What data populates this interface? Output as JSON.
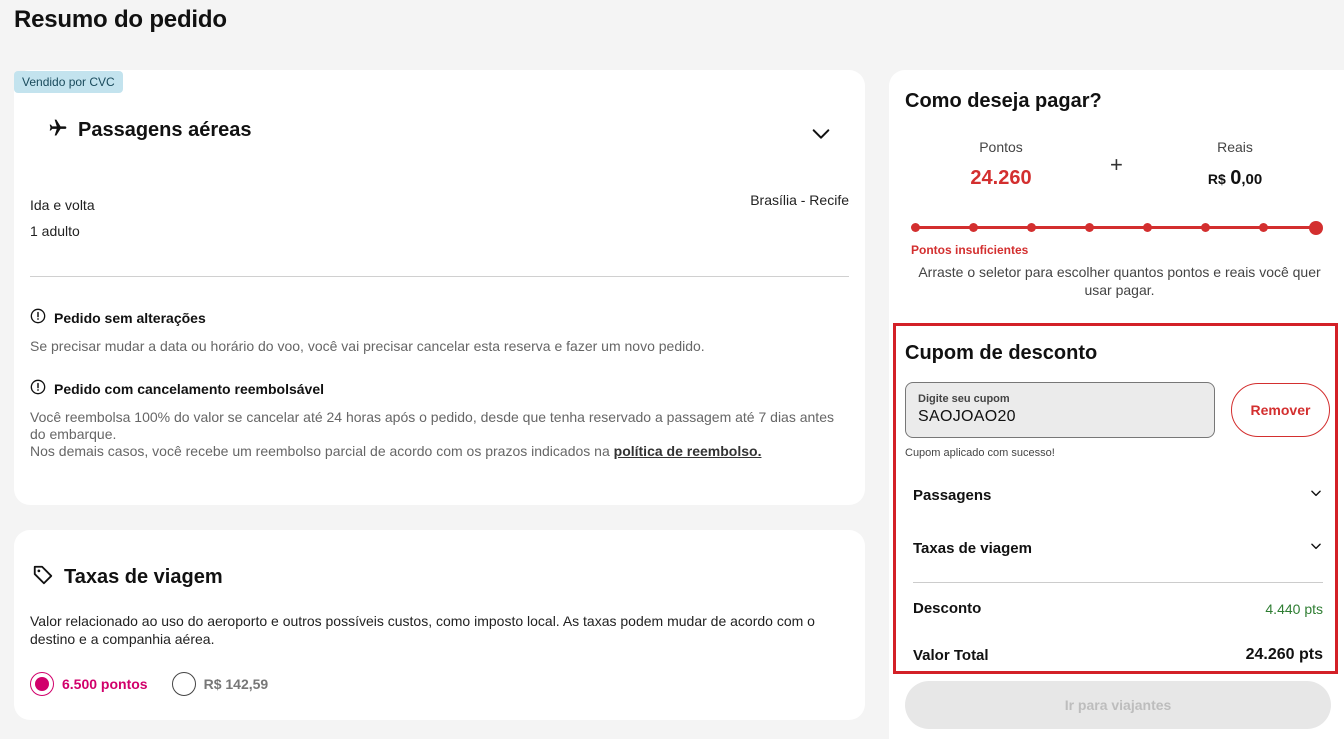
{
  "page": {
    "title": "Resumo do pedido"
  },
  "flight": {
    "badge": "Vendido por CVC",
    "title": "Passagens aéreas",
    "trip_type": "Ida e volta",
    "passengers": "1 adulto",
    "route": "Brasília - Recife",
    "notices": [
      {
        "title": "Pedido sem alterações",
        "body": "Se precisar mudar a data ou horário do voo, você vai precisar cancelar esta reserva e fazer um novo pedido."
      },
      {
        "title": "Pedido com cancelamento reembolsável",
        "body": "Você reembolsa 100% do valor se cancelar até 24 horas após o pedido, desde que tenha reservado a passagem até 7 dias antes do embarque.",
        "body2": "Nos demais casos, você recebe um reembolso parcial de acordo com os prazos indicados na",
        "link": "política de reembolso."
      }
    ]
  },
  "taxes": {
    "title": "Taxas de viagem",
    "description": "Valor relacionado ao uso do aeroporto e outros possíveis custos, como imposto local. As taxas podem mudar de acordo com o destino e a companhia aérea.",
    "options": [
      {
        "label": "6.500 pontos",
        "selected": true
      },
      {
        "label": "R$ 142,59",
        "selected": false
      }
    ]
  },
  "payment": {
    "title": "Como deseja pagar?",
    "points_label": "Pontos",
    "points_value": "24.260",
    "plus": "+",
    "reais_label": "Reais",
    "reais_currency": "R$",
    "reais_int": "0",
    "reais_dec": ",00",
    "slider_level": 1.0,
    "insufficient": "Pontos insuficientes",
    "hint": "Arraste o seletor para escolher quantos pontos e reais você quer usar pagar."
  },
  "coupon": {
    "title": "Cupom de desconto",
    "placeholder": "Digite seu cupom",
    "value": "SAOJOAO20",
    "remove_label": "Remover",
    "success": "Cupom aplicado com sucesso!"
  },
  "summary": {
    "passagens": "Passagens",
    "taxas": "Taxas de viagem",
    "desconto_label": "Desconto",
    "desconto_value": "4.440 pts",
    "total_label": "Valor Total",
    "total_value": "24.260 pts"
  },
  "cta": {
    "label": "Ir para viajantes"
  },
  "colors": {
    "accent_red": "#d32f2f",
    "pink": "#d1006b",
    "green": "#2e7d32",
    "badge_bg": "#c3e3ee"
  }
}
